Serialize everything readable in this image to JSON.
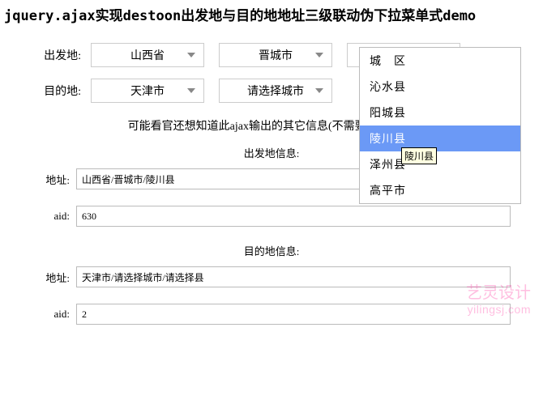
{
  "title": "jquery.ajax实现destoon出发地与目的地地址三级联动伪下拉菜单式demo",
  "labels": {
    "from": "出发地:",
    "to": "目的地:"
  },
  "from": {
    "province": "山西省",
    "city": "晋城市",
    "county": "陵川县"
  },
  "to": {
    "province": "天津市",
    "city": "请选择城市",
    "county": ""
  },
  "dropdown": {
    "options": [
      "城　区",
      "沁水县",
      "阳城县",
      "陵川县",
      "泽州县",
      "高平市"
    ],
    "selected_index": 3,
    "tooltip": "陵川县"
  },
  "subtitle": "可能看官还想知道此ajax输出的其它信息(不需要的请无视)",
  "info": {
    "from_head": "出发地信息:",
    "to_head": "目的地信息:",
    "addr_label": "地址:",
    "aid_label": "aid:",
    "from_addr": "山西省/晋城市/陵川县",
    "from_aid": "630",
    "to_addr": "天津市/请选择城市/请选择县",
    "to_aid": "2"
  },
  "watermark": {
    "line1": "艺灵设计",
    "line2": "yilingsj.com"
  }
}
